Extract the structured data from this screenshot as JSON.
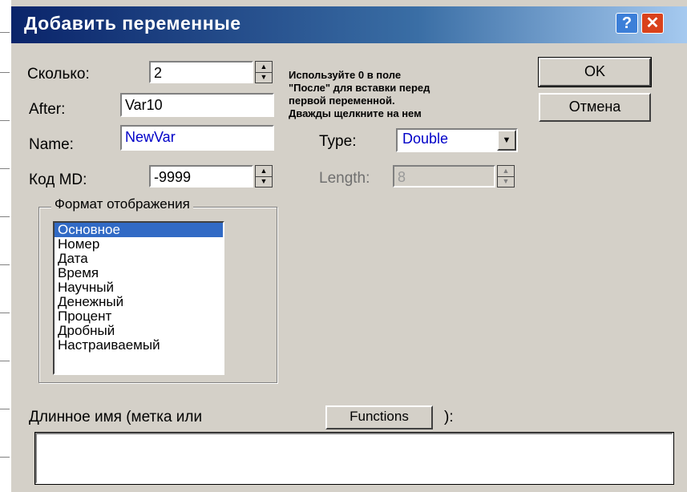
{
  "window": {
    "title": "Добавить переменные",
    "help_label": "?",
    "close_label": "✕"
  },
  "fields": {
    "count_label": "Сколько:",
    "count_value": "2",
    "after_label": "After:",
    "after_value": "Var10",
    "name_label": "Name:",
    "name_value": "NewVar",
    "md_label": "Код MD:",
    "md_value": "-9999",
    "type_label": "Type:",
    "type_value": "Double",
    "length_label": "Length:",
    "length_value": "8"
  },
  "note_lines": [
    "Используйте 0 в поле",
    "\"После\" для вставки перед",
    "первой переменной.",
    "Дважды щелкните на нем"
  ],
  "buttons": {
    "ok": "OK",
    "cancel": "Отмена",
    "functions": "Functions"
  },
  "format_group": {
    "title": "Формат отображения",
    "items": [
      "Основное",
      "Номер",
      "Дата",
      "Время",
      "Научный",
      "Денежный",
      "Процент",
      "Дробный",
      "Настраиваемый"
    ],
    "selected": "Основное"
  },
  "long_name": {
    "label": "Длинное имя (метка или",
    "suffix": "):",
    "value": ""
  },
  "icons": [
    "spin-up-icon",
    "spin-down-icon",
    "dropdown-arrow-icon",
    "help-icon",
    "close-icon"
  ],
  "colors": {
    "titlebar_start": "#0a246a",
    "titlebar_end": "#a6caf0",
    "selection": "#316ac5",
    "type_text": "#0000c8",
    "close_button": "#d9421c"
  }
}
